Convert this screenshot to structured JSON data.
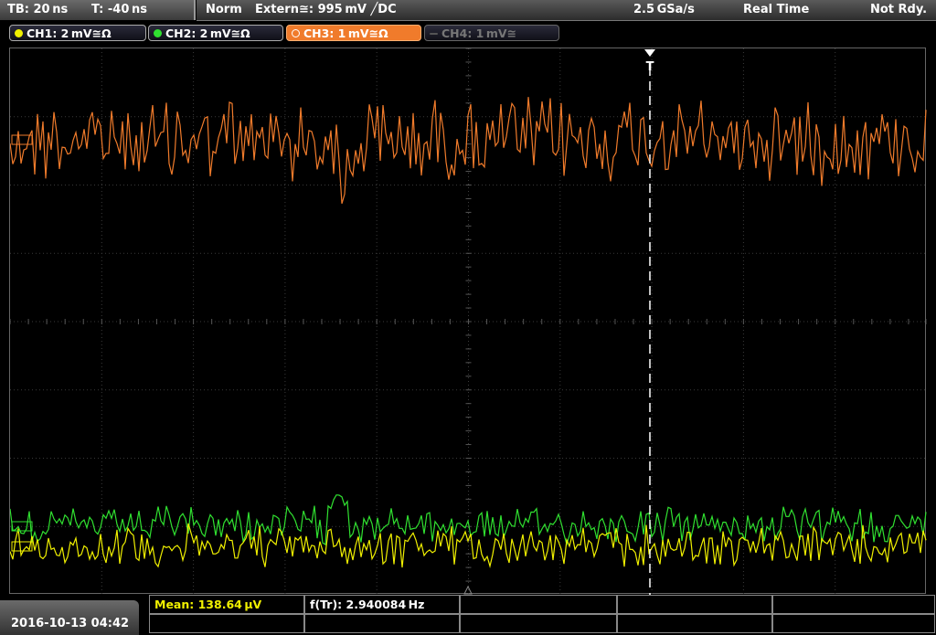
{
  "header": {
    "timebase": "TB: 20 ns",
    "trigger_time": "T: -40 ns",
    "mode": "Norm",
    "trigger_source": "Extern≅: 995 mV ╱DC",
    "sample_rate": "2.5 GSa/s",
    "acq_mode": "Real Time",
    "status": "Not Rdy."
  },
  "channels": [
    {
      "label": "CH1: 2 mV≅Ω",
      "color": "#f0f000",
      "state": "on"
    },
    {
      "label": "CH2: 2 mV≅Ω",
      "color": "#30e030",
      "state": "on"
    },
    {
      "label": "CH3: 1 mV≅Ω",
      "color": "#f07b2b",
      "state": "active"
    },
    {
      "label": "CH4: 1 mV≅",
      "color": "#777777",
      "state": "off"
    }
  ],
  "trigger_marker": "T",
  "footer": {
    "datetime": "2016-10-13 04:42",
    "measurement_1": "Mean: 138.64 μV",
    "measurement_2": "f(Tr): 2.940084 Hz"
  },
  "colors": {
    "ch1": "#f0f000",
    "ch2": "#30e030",
    "ch3": "#f07b2b",
    "grid": "#3a3a3a"
  }
}
